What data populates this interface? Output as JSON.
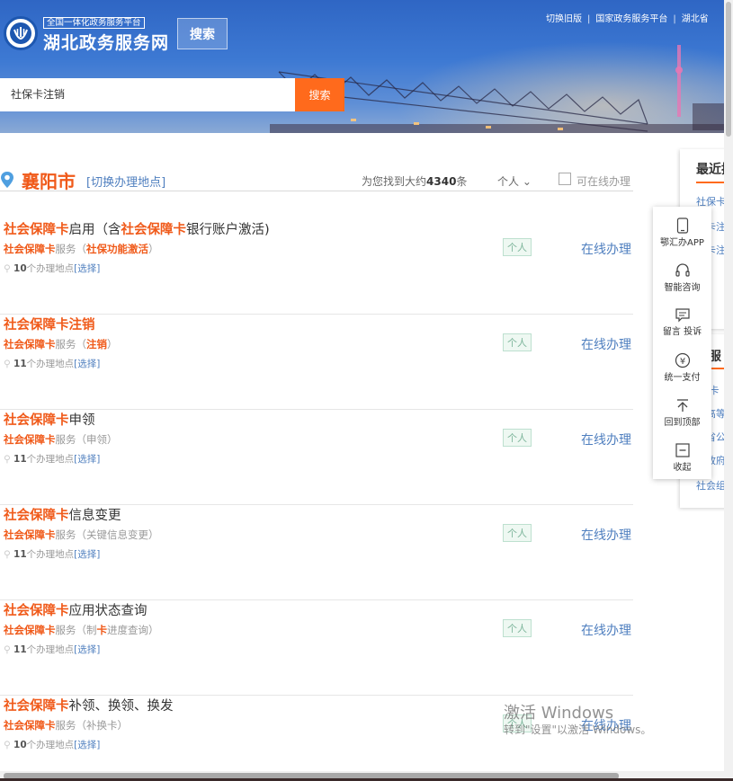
{
  "header": {
    "platform_tag": "全国一体化政务服务平台",
    "site_name": "湖北政务服务网",
    "top_search_label": "搜索",
    "nav": [
      "切换旧版",
      "国家政务服务平台",
      "湖北省"
    ],
    "search": {
      "value": "社保卡注销",
      "button": "搜索"
    }
  },
  "location": {
    "city": "襄阳市",
    "switch_label": "[切换办理地点]",
    "found_prefix": "为您找到大约",
    "found_count": "4340",
    "found_suffix": "条",
    "person_filter": "个人 ⌄",
    "online_filter": "可在线办理"
  },
  "results": [
    {
      "title_hl": "社会保障卡",
      "title_rest": "启用（含",
      "title_hl2": "社会保障卡",
      "title_rest2": "银行账户激活)",
      "sub_hl": "社会保障卡",
      "sub_mid": "服务（",
      "sub_hl2": "社保功能激活",
      "sub_end": "）",
      "count": "10",
      "places": "个办理地点",
      "choose": "[选择]",
      "tag": "个人",
      "action": "在线办理"
    },
    {
      "title_hl": "社会保障卡注销",
      "title_rest": "",
      "title_hl2": "",
      "title_rest2": "",
      "sub_hl": "社会保障卡",
      "sub_mid": "服务（",
      "sub_hl2": "注销",
      "sub_end": "）",
      "count": "11",
      "places": "个办理地点",
      "choose": "[选择]",
      "tag": "个人",
      "action": "在线办理"
    },
    {
      "title_hl": "社会保障卡",
      "title_rest": "申领",
      "title_hl2": "",
      "title_rest2": "",
      "sub_hl": "社会保障卡",
      "sub_mid": "服务（申领）",
      "sub_hl2": "",
      "sub_end": "",
      "count": "11",
      "places": "个办理地点",
      "choose": "[选择]",
      "tag": "个人",
      "action": "在线办理"
    },
    {
      "title_hl": "社会保障卡",
      "title_rest": "信息变更",
      "title_hl2": "",
      "title_rest2": "",
      "sub_hl": "社会保障卡",
      "sub_mid": "服务（关键信息变更）",
      "sub_hl2": "",
      "sub_end": "",
      "count": "11",
      "places": "个办理地点",
      "choose": "[选择]",
      "tag": "个人",
      "action": "在线办理"
    },
    {
      "title_hl": "社会保障卡",
      "title_rest": "应用状态查询",
      "title_hl2": "",
      "title_rest2": "",
      "sub_hl": "社会保障卡",
      "sub_mid": "服务（制",
      "sub_hl2": "卡",
      "sub_end": "进度查询）",
      "count": "11",
      "places": "个办理地点",
      "choose": "[选择]",
      "tag": "个人",
      "action": "在线办理"
    },
    {
      "title_hl": "社会保障卡",
      "title_rest": "补领、换领、换发",
      "title_hl2": "",
      "title_rest2": "",
      "sub_hl": "社会保障卡",
      "sub_mid": "服务（补换卡）",
      "sub_hl2": "",
      "sub_end": "",
      "count": "10",
      "places": "个办理地点",
      "choose": "[选择]",
      "tag": "个人",
      "action": "在线办理"
    }
  ],
  "side": {
    "recent_heading": "最近搜",
    "recent_links": [
      "社保卡注",
      "保卡注",
      "保卡注"
    ],
    "dept_heading": "门服",
    "dept_links": [
      "保 卡",
      "北高等",
      "北省公",
      "北政府",
      "社会组织"
    ]
  },
  "float_bar": [
    {
      "label": "鄂汇办APP",
      "icon": "phone-icon"
    },
    {
      "label": "智能咨询",
      "icon": "headset-icon"
    },
    {
      "label": "留言 投诉",
      "icon": "message-icon"
    },
    {
      "label": "统一支付",
      "icon": "yuan-icon"
    },
    {
      "label": "回到顶部",
      "icon": "back-to-top-icon"
    },
    {
      "label": "收起",
      "icon": "collapse-icon"
    }
  ],
  "watermark": {
    "title": "激活 Windows",
    "sub": "转到\"设置\"以激活 Windows。"
  },
  "colors": {
    "accent": "#f05a1a",
    "search_button": "#ff6a1c",
    "link": "#4f7fbf",
    "header_blue": "#2f66c4"
  }
}
